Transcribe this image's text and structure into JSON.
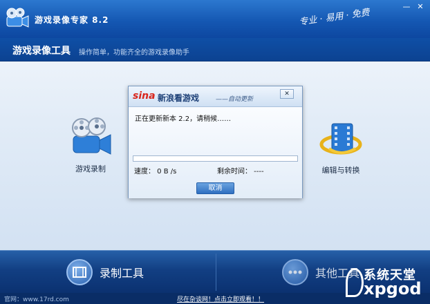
{
  "window": {
    "title": "游戏录像专家 8.2",
    "slogan": "专业 · 易用 · 免费",
    "minimize_glyph": "—",
    "close_glyph": "✕"
  },
  "header": {
    "title": "游戏录像工具",
    "description": "操作简单，功能齐全的游戏录像助手"
  },
  "features": {
    "record_label": "游戏录制",
    "edit_label": "编辑与转换"
  },
  "dialog": {
    "sina_logo": "sina",
    "brand": "新浪看游戏",
    "subtitle": "——自动更新",
    "close_glyph": "✕",
    "status": "正在更新新本 2.2，请稍候……",
    "progress_fraction": 0.0,
    "speed_label": "速度：  0 B /s",
    "remaining_label": "剩余时间：   ----",
    "cancel_label": "取消"
  },
  "toolbar": {
    "record_tool_label": "录制工具",
    "other_tool_label": "其他工具"
  },
  "footer": {
    "site": "官网：www.17rd.com",
    "link": "尽在杂谈网！点击立即观看！！"
  },
  "watermark": {
    "top": "系统天堂",
    "bottom": "xpgod"
  },
  "colors": {
    "title_bar": "#1558b3",
    "accent": "#2f6fc0",
    "sina_red": "#d9261c"
  }
}
